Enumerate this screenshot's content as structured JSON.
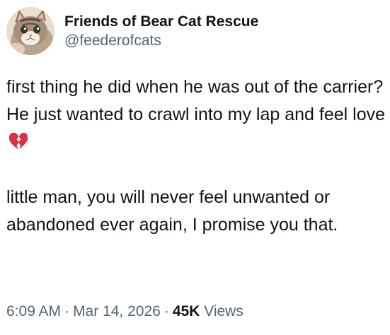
{
  "author": {
    "display_name": "Friends of Bear Cat Rescue",
    "handle": "@feederofcats",
    "avatar_icon": "kitten-avatar"
  },
  "tweet": {
    "paragraphs": [
      "first thing he did when he was out of the carrier? He just wanted to crawl into my lap and feel love",
      "little man, you will never feel unwanted or abandoned ever again, I promise you that."
    ],
    "emoji_icon": "broken-heart-emoji"
  },
  "meta": {
    "time": "6:09 AM",
    "separator": "·",
    "date": "Mar 14, 2026",
    "views_count": "45K",
    "views_label": "Views"
  },
  "colors": {
    "text_primary": "#0f1419",
    "text_secondary": "#536471",
    "emoji_red": "#dd2e44"
  }
}
